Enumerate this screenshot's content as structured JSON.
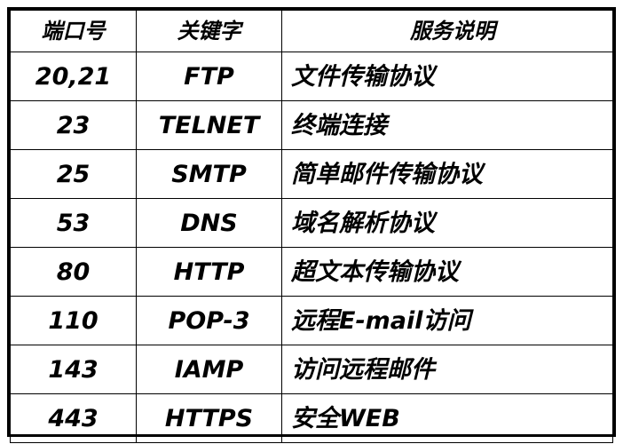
{
  "table": {
    "headers": {
      "port": "端口号",
      "keyword": "关键字",
      "description": "服务说明"
    },
    "rows": [
      {
        "port": "20,21",
        "keyword": "FTP",
        "description": "文件传输协议"
      },
      {
        "port": "23",
        "keyword": "TELNET",
        "description": "终端连接"
      },
      {
        "port": "25",
        "keyword": "SMTP",
        "description": "简单邮件传输协议"
      },
      {
        "port": "53",
        "keyword": "DNS",
        "description": "域名解析协议"
      },
      {
        "port": "80",
        "keyword": "HTTP",
        "description": "超文本传输协议"
      },
      {
        "port": "110",
        "keyword": "POP-3",
        "description": "远程E-mail访问"
      },
      {
        "port": "143",
        "keyword": "IAMP",
        "description": "访问远程邮件"
      },
      {
        "port": "443",
        "keyword": "HTTPS",
        "description": "安全WEB"
      }
    ]
  }
}
